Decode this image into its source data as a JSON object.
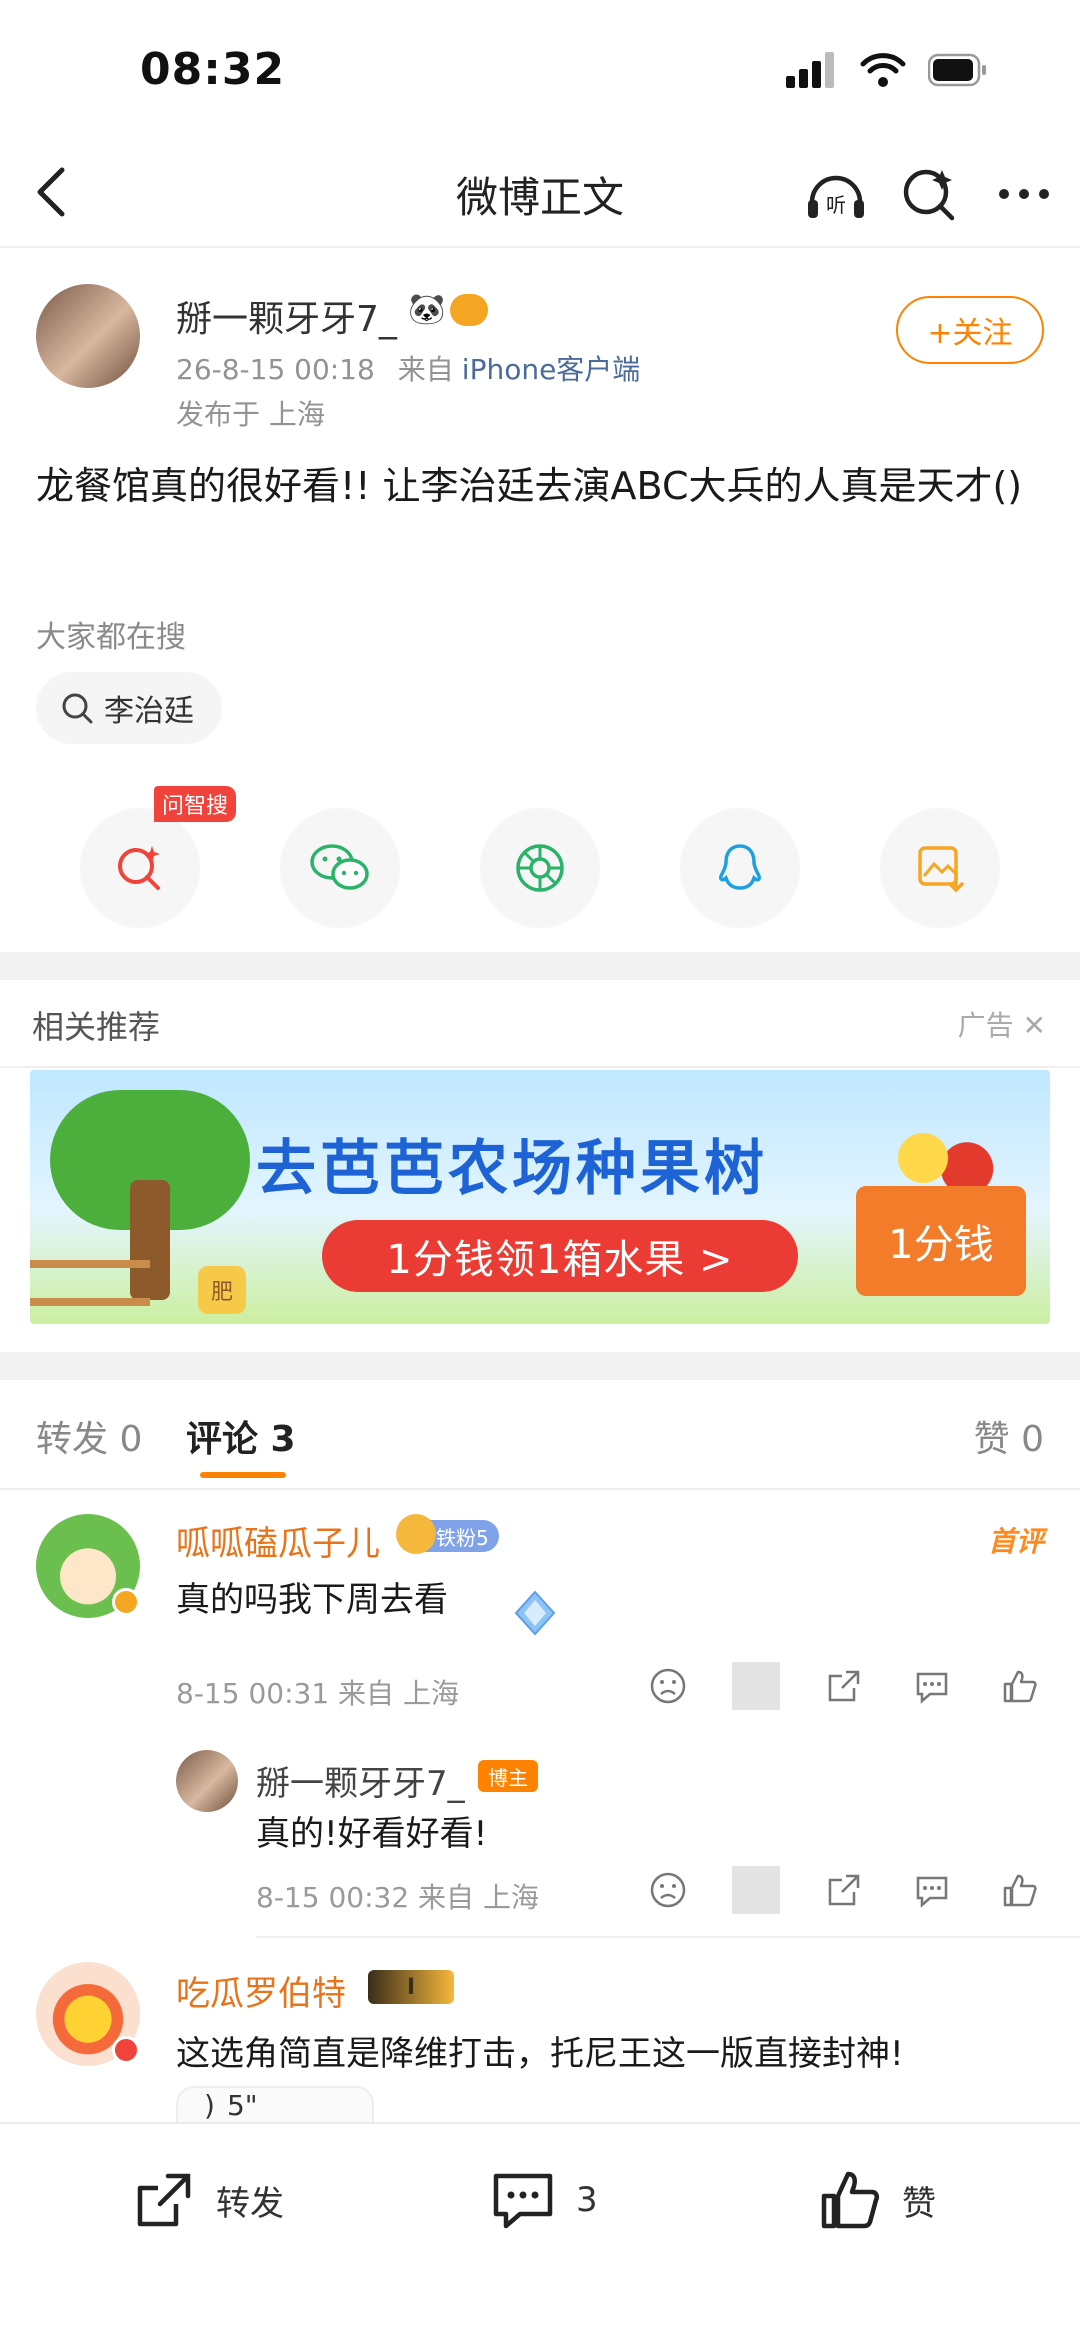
{
  "status_bar": {
    "time": "08:32"
  },
  "nav": {
    "title": "微博正文",
    "listen_icon_text": "听"
  },
  "post": {
    "author": "掰一颗牙牙7_",
    "time": "26-8-15 00:18",
    "source_prefix": "来自",
    "source": "iPhone客户端",
    "location": "发布于 上海",
    "follow_label": "+关注",
    "text": "龙餐馆真的很好看!! 让李治廷去演ABC大兵的人真是天才()",
    "search_label": "大家都在搜",
    "search_chip": "李治廷",
    "share_tag": "问智搜"
  },
  "recommend": {
    "title": "相关推荐",
    "ad_label": "广告",
    "ad_headline": "去芭芭农场种果树",
    "ad_cta": "1分钱领1箱水果 >",
    "ad_box": "1分钱",
    "ad_jar": "肥"
  },
  "tabs": [
    {
      "label": "转发 0"
    },
    {
      "label": "评论 3"
    },
    {
      "label": "赞 0"
    }
  ],
  "comments": [
    {
      "name": "呱呱磕瓜子儿",
      "fan_badge": "铁粉5",
      "first_tag": "首评",
      "text": "真的吗我下周去看",
      "meta": "8-15 00:31 来自 上海"
    },
    {
      "name": "掰一颗牙牙7_",
      "blogger_tag": "博主",
      "text": "真的!好看好看!",
      "meta": "8-15 00:32 来自 上海"
    },
    {
      "name": "吃瓜罗伯特",
      "level_badge": "I",
      "text": "这选角简直是降维打击，托尼王这一版直接封神!",
      "voice": "5\""
    }
  ],
  "bottom_bar": {
    "repost": "转发",
    "comment_count": "3",
    "like": "赞"
  },
  "colors": {
    "accent": "#ff8200",
    "name": "#e8731a",
    "link": "#4a6b9c",
    "ad_blue": "#1e63d6",
    "ad_red": "#ea3b34"
  }
}
